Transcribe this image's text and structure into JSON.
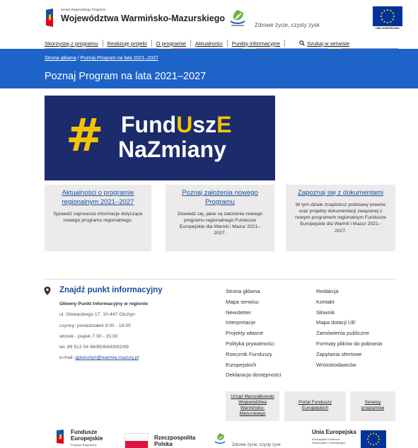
{
  "header": {
    "small_line": "Serwis Regionalnego Programu",
    "title": "Województwa Warmińsko-Mazurskiego",
    "healthy_logo_text": "Zdrowe życie, czysty zysk",
    "eu_label": "UNIA EUROPEJSKA"
  },
  "nav": {
    "items": [
      "Skorzystaj z programu",
      "Realizuję projekt",
      "O programie",
      "Aktualności",
      "Punkty informacyjne"
    ],
    "search_label": "Szukaj w serwisie"
  },
  "breadcrumb": {
    "home": "Strona główna",
    "separator": "/",
    "current": "Poznaj Program na lata 2021–2027"
  },
  "page_title": "Poznaj Program na lata 2021–2027",
  "hero": {
    "hash": "#",
    "line1_a": "Fund",
    "line1_u": "U",
    "line1_b": "sz",
    "line1_e": "E",
    "line2": "NaZmiany"
  },
  "cards": [
    {
      "title": "Aktualności o programie regionalnym 2021–2027",
      "desc": "Sprawdź najnowsze informacje dotyczące nowego programu regionalnego."
    },
    {
      "title": "Poznaj założenia nowego Programu",
      "desc": "Dowiedz się, jakie są założenia nowego programu regionalnego Fundusze Europejskie dla Warmii i Mazur 2021–2027."
    },
    {
      "title": "Zapoznaj się z dokumentami",
      "desc": "W tym dziale znajdziesz podstawy prawne oraz projekty dokumentacji związanej z nowym programem regionalnym Fundusze Europejskie dla Warmii i Mazur 2021–2027."
    }
  ],
  "find_point": {
    "title": "Znajdź punkt informacyjny",
    "subtitle": "Główny Punkt Informacyjny w regionie",
    "address": "ul. Głowackiego 17, 10-447 Olsztyn",
    "hours1": "czynny: poniedziałek 8:00 - 18:00",
    "hours2": "wtorek - piątek 7:30 - 15:30",
    "phone": "tel. 89 512 54 86/85/84/83/82/89",
    "email_label": "e-mail:",
    "email": "gpiolsztyn@warmia.mazury.pl"
  },
  "footer_links_col1": [
    "Strona główna",
    "Mapa serwisu",
    "Newsletter",
    "Interpretacje",
    "Projekty własne",
    "Polityka prywatności",
    "Rzecznik Funduszy",
    "Europejskich",
    "Deklaracja dostępności"
  ],
  "footer_links_col2": [
    "Redakcja",
    "Kontakt",
    "Słownik",
    "Mapa dotacji UE",
    "Zamówienia publiczne",
    "Formaty plików do pobrania",
    "Zapytania ofertowe",
    "Wnioskodawców"
  ],
  "bottom_links": [
    {
      "l1": "Urząd Marszałkowski",
      "l2": "Województwa",
      "l3": "Warmińsko-",
      "l4": "Mazurskiego"
    },
    {
      "l1": "Portal Funduszy",
      "l2": "Europejskich",
      "l3": "",
      "l4": ""
    },
    {
      "l1": "Serwisy",
      "l2": "programów",
      "l3": "",
      "l4": ""
    }
  ],
  "footer_logos": {
    "fe_line1": "Fundusze",
    "fe_line2": "Europejskie",
    "fe_sub": "Program Regionalny",
    "pl_line1": "Rzeczpospolita",
    "pl_line2": "Polska",
    "healthy": "Zdrowe życie, czysty zysk",
    "eu_title": "Unia Europejska",
    "eu_sub1": "Europejskie Fundusze",
    "eu_sub2": "Strukturalne i Inwestycyjne"
  },
  "colors": {
    "blue": "#1e63c8",
    "link": "#1a4fa0",
    "hero_bg": "#1b2b6b",
    "yellow": "#f5c400",
    "card_bg": "#eceaea"
  }
}
